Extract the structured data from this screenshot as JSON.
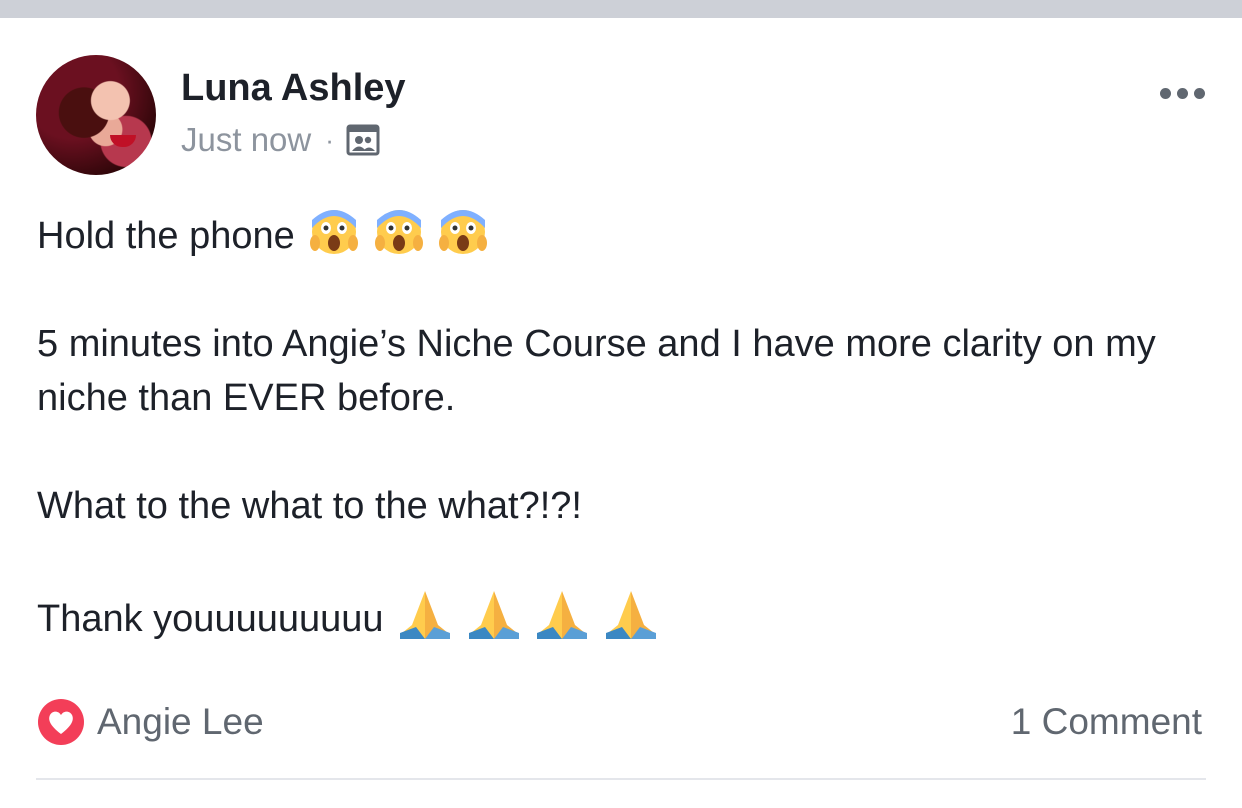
{
  "post": {
    "author": "Luna Ashley",
    "timestamp": "Just now",
    "separator": "·",
    "audience_icon": "friends-audience-icon",
    "body": {
      "line1": "Hold the phone",
      "line1_emoji": "face-screaming-in-fear x3",
      "line2": "5 minutes into Angie’s Niche Course and I have more clarity on my niche than EVER before.",
      "line3": "What to the what to the what?!?!",
      "line4": "Thank youuuuuuuuu",
      "line4_emoji": "folded-hands x4"
    }
  },
  "reactions": {
    "icon": "love-reaction-icon",
    "names": "Angie Lee",
    "color": "#f33e58"
  },
  "comments": {
    "count_label": "1 Comment"
  },
  "colors": {
    "top_band": "#cdd0d7",
    "secondary_text": "#8d949e",
    "divider": "#e4e6eb"
  }
}
